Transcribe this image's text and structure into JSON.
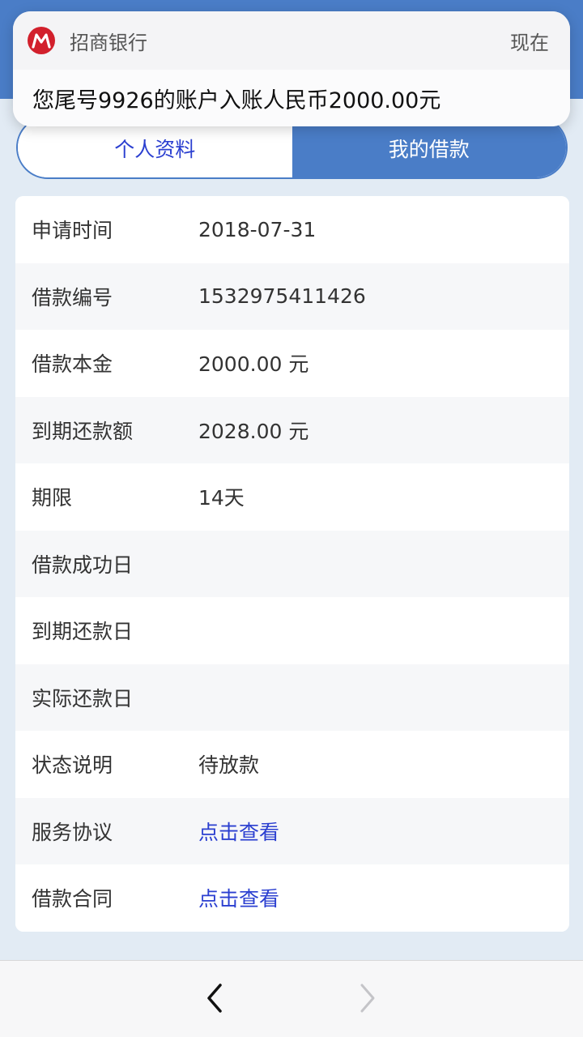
{
  "notification": {
    "app_name": "招商银行",
    "time": "现在",
    "message": "您尾号9926的账户入账人民币2000.00元",
    "brand_color": "#d2202c"
  },
  "tabs": [
    {
      "label": "个人资料",
      "active": false
    },
    {
      "label": "我的借款",
      "active": true
    }
  ],
  "loan_details": [
    {
      "label": "申请时间",
      "value": "2018-07-31"
    },
    {
      "label": "借款编号",
      "value": "1532975411426"
    },
    {
      "label": "借款本金",
      "value": "2000.00 元"
    },
    {
      "label": "到期还款额",
      "value": "2028.00 元"
    },
    {
      "label": "期限",
      "value": "14天"
    },
    {
      "label": "借款成功日",
      "value": ""
    },
    {
      "label": "到期还款日",
      "value": ""
    },
    {
      "label": "实际还款日",
      "value": ""
    },
    {
      "label": "状态说明",
      "value": "待放款"
    },
    {
      "label": "服务协议",
      "value": "点击查看",
      "link": true
    },
    {
      "label": "借款合同",
      "value": "点击查看",
      "link": true
    }
  ],
  "colors": {
    "accent": "#4a7dc7",
    "link": "#2b3fd0",
    "background": "#e2ebf4"
  },
  "nav": {
    "back_icon": "chevron-left-icon",
    "forward_icon": "chevron-right-icon"
  }
}
